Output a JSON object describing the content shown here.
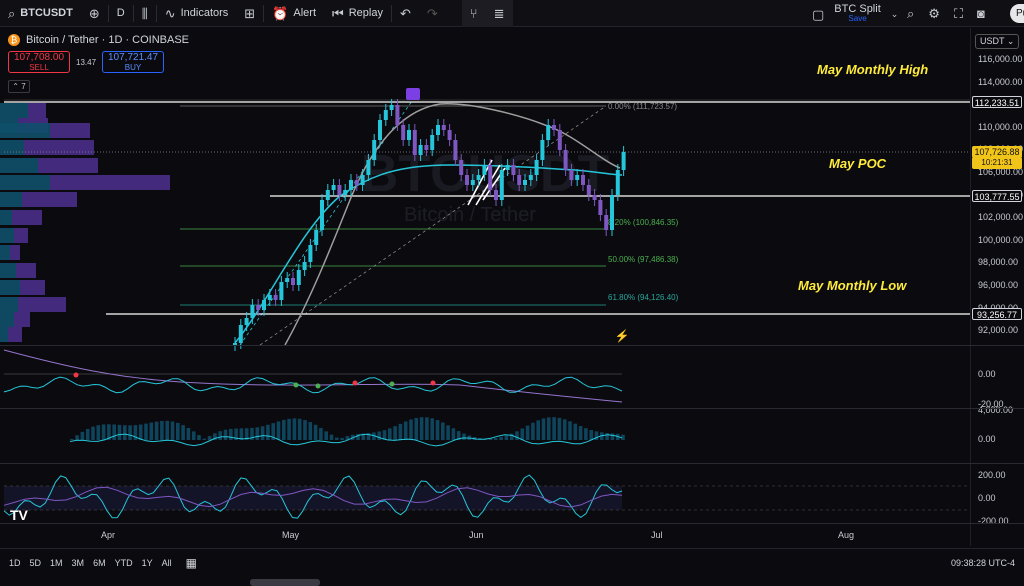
{
  "toolbar": {
    "symbol": "BTCUSDT",
    "interval": "D",
    "indicators_label": "Indicators",
    "alert_label": "Alert",
    "replay_label": "Replay",
    "layout_name": "BTC Split",
    "layout_status": "Save",
    "publish_label": "Pu"
  },
  "legend": {
    "title": "Bitcoin / Tether · 1D · COINBASE",
    "sell_price": "107,708.00",
    "sell_label": "SELL",
    "spread": "13.47",
    "buy_price": "107,721.47",
    "buy_label": "BUY",
    "indicator_count": "7"
  },
  "watermark": {
    "symbol": "BTCUSDT",
    "name": "Bitcoin / Tether"
  },
  "currency_select": "USDT",
  "price_axis": {
    "ticks": [
      "116,000.00",
      "114,000.00",
      "112,000.00",
      "110,000.00",
      "108,000.00",
      "106,000.00",
      "104,000.00",
      "102,000.00",
      "100,000.00",
      "98,000.00",
      "96,000.00",
      "94,000.00",
      "92,000.00"
    ],
    "boxes": {
      "may_high": "112,233.51",
      "current": "107,726.88",
      "countdown": "10:21:31",
      "poc": "103,777.55",
      "may_low": "93,256.77"
    },
    "osc1_ticks": [
      "0.00",
      "-20.00"
    ],
    "osc2_ticks": [
      "4,000.00",
      "0.00"
    ],
    "osc3_ticks": [
      "200.00",
      "0.00",
      "-200.00"
    ]
  },
  "annotations": {
    "may_high": "May Monthly High",
    "may_poc": "May POC",
    "may_low": "May Monthly Low"
  },
  "fib_levels": {
    "f0": "0.00% (111,723.57)",
    "f38": "8.20% (100,846.35)",
    "f50": "50.00% (97,486.38)",
    "f618": "61.80% (94,126.40)"
  },
  "time_axis": [
    "Apr",
    "May",
    "Jun",
    "Jul",
    "Aug"
  ],
  "ranges": [
    "1D",
    "5D",
    "1M",
    "3M",
    "6M",
    "YTD",
    "1Y",
    "All"
  ],
  "clock": "09:38:28 UTC-4",
  "colors": {
    "bull": "#26c6da",
    "bear": "#7e57c2",
    "annotation": "#ffeb3b",
    "current_price": "#f0c419"
  }
}
